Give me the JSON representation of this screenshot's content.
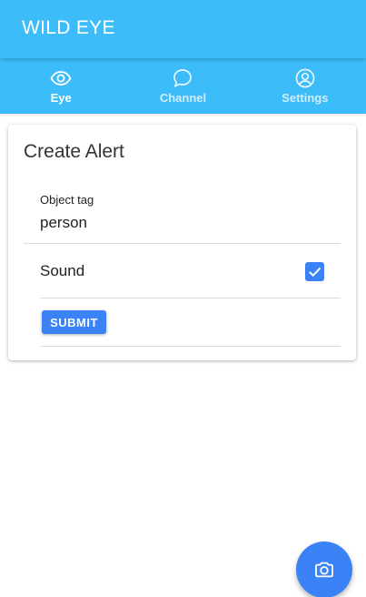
{
  "app": {
    "title": "WILD EYE"
  },
  "tabs": [
    {
      "label": "Eye",
      "icon": "eye-icon",
      "active": true
    },
    {
      "label": "Channel",
      "icon": "chat-bubble-icon",
      "active": false
    },
    {
      "label": "Settings",
      "icon": "account-circle-icon",
      "active": false
    }
  ],
  "card": {
    "title": "Create Alert",
    "object_tag": {
      "label": "Object tag",
      "value": "person"
    },
    "sound": {
      "label": "Sound",
      "checked": true
    },
    "submit_label": "SUBMIT"
  },
  "fab": {
    "icon": "camera-icon"
  },
  "colors": {
    "primary_bar": "#3dbcfa",
    "accent": "#3b82f6"
  }
}
